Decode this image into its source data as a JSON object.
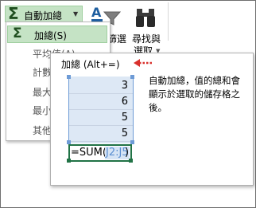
{
  "ribbon": {
    "autosum_label": "自動加總",
    "sort_filter_label": "篩選",
    "find_select_label_1": "尋找與",
    "find_select_label_2": "選取"
  },
  "autosum_menu": {
    "items": [
      {
        "label": "加總(S)",
        "selected": true,
        "icon": "sigma-icon"
      },
      {
        "label": "平均值(A)"
      },
      {
        "label": "計數"
      },
      {
        "label": "最大"
      },
      {
        "label": "最小"
      },
      {
        "label": "其他"
      }
    ]
  },
  "tooltip": {
    "title": "加總 (Alt+=)",
    "description": "自動加總，值的總和會顯示於選取的儲存格之後。",
    "cells": [
      "3",
      "6",
      "5",
      "5"
    ],
    "formula_prefix": "=SUM(",
    "formula_ref": "J2:J5",
    "formula_suffix": ")"
  },
  "colors": {
    "accent_green": "#217346",
    "selection_fill": "#c5e3c5",
    "range_blue": "#6e9bd6",
    "arrow_red": "#d9302c"
  }
}
